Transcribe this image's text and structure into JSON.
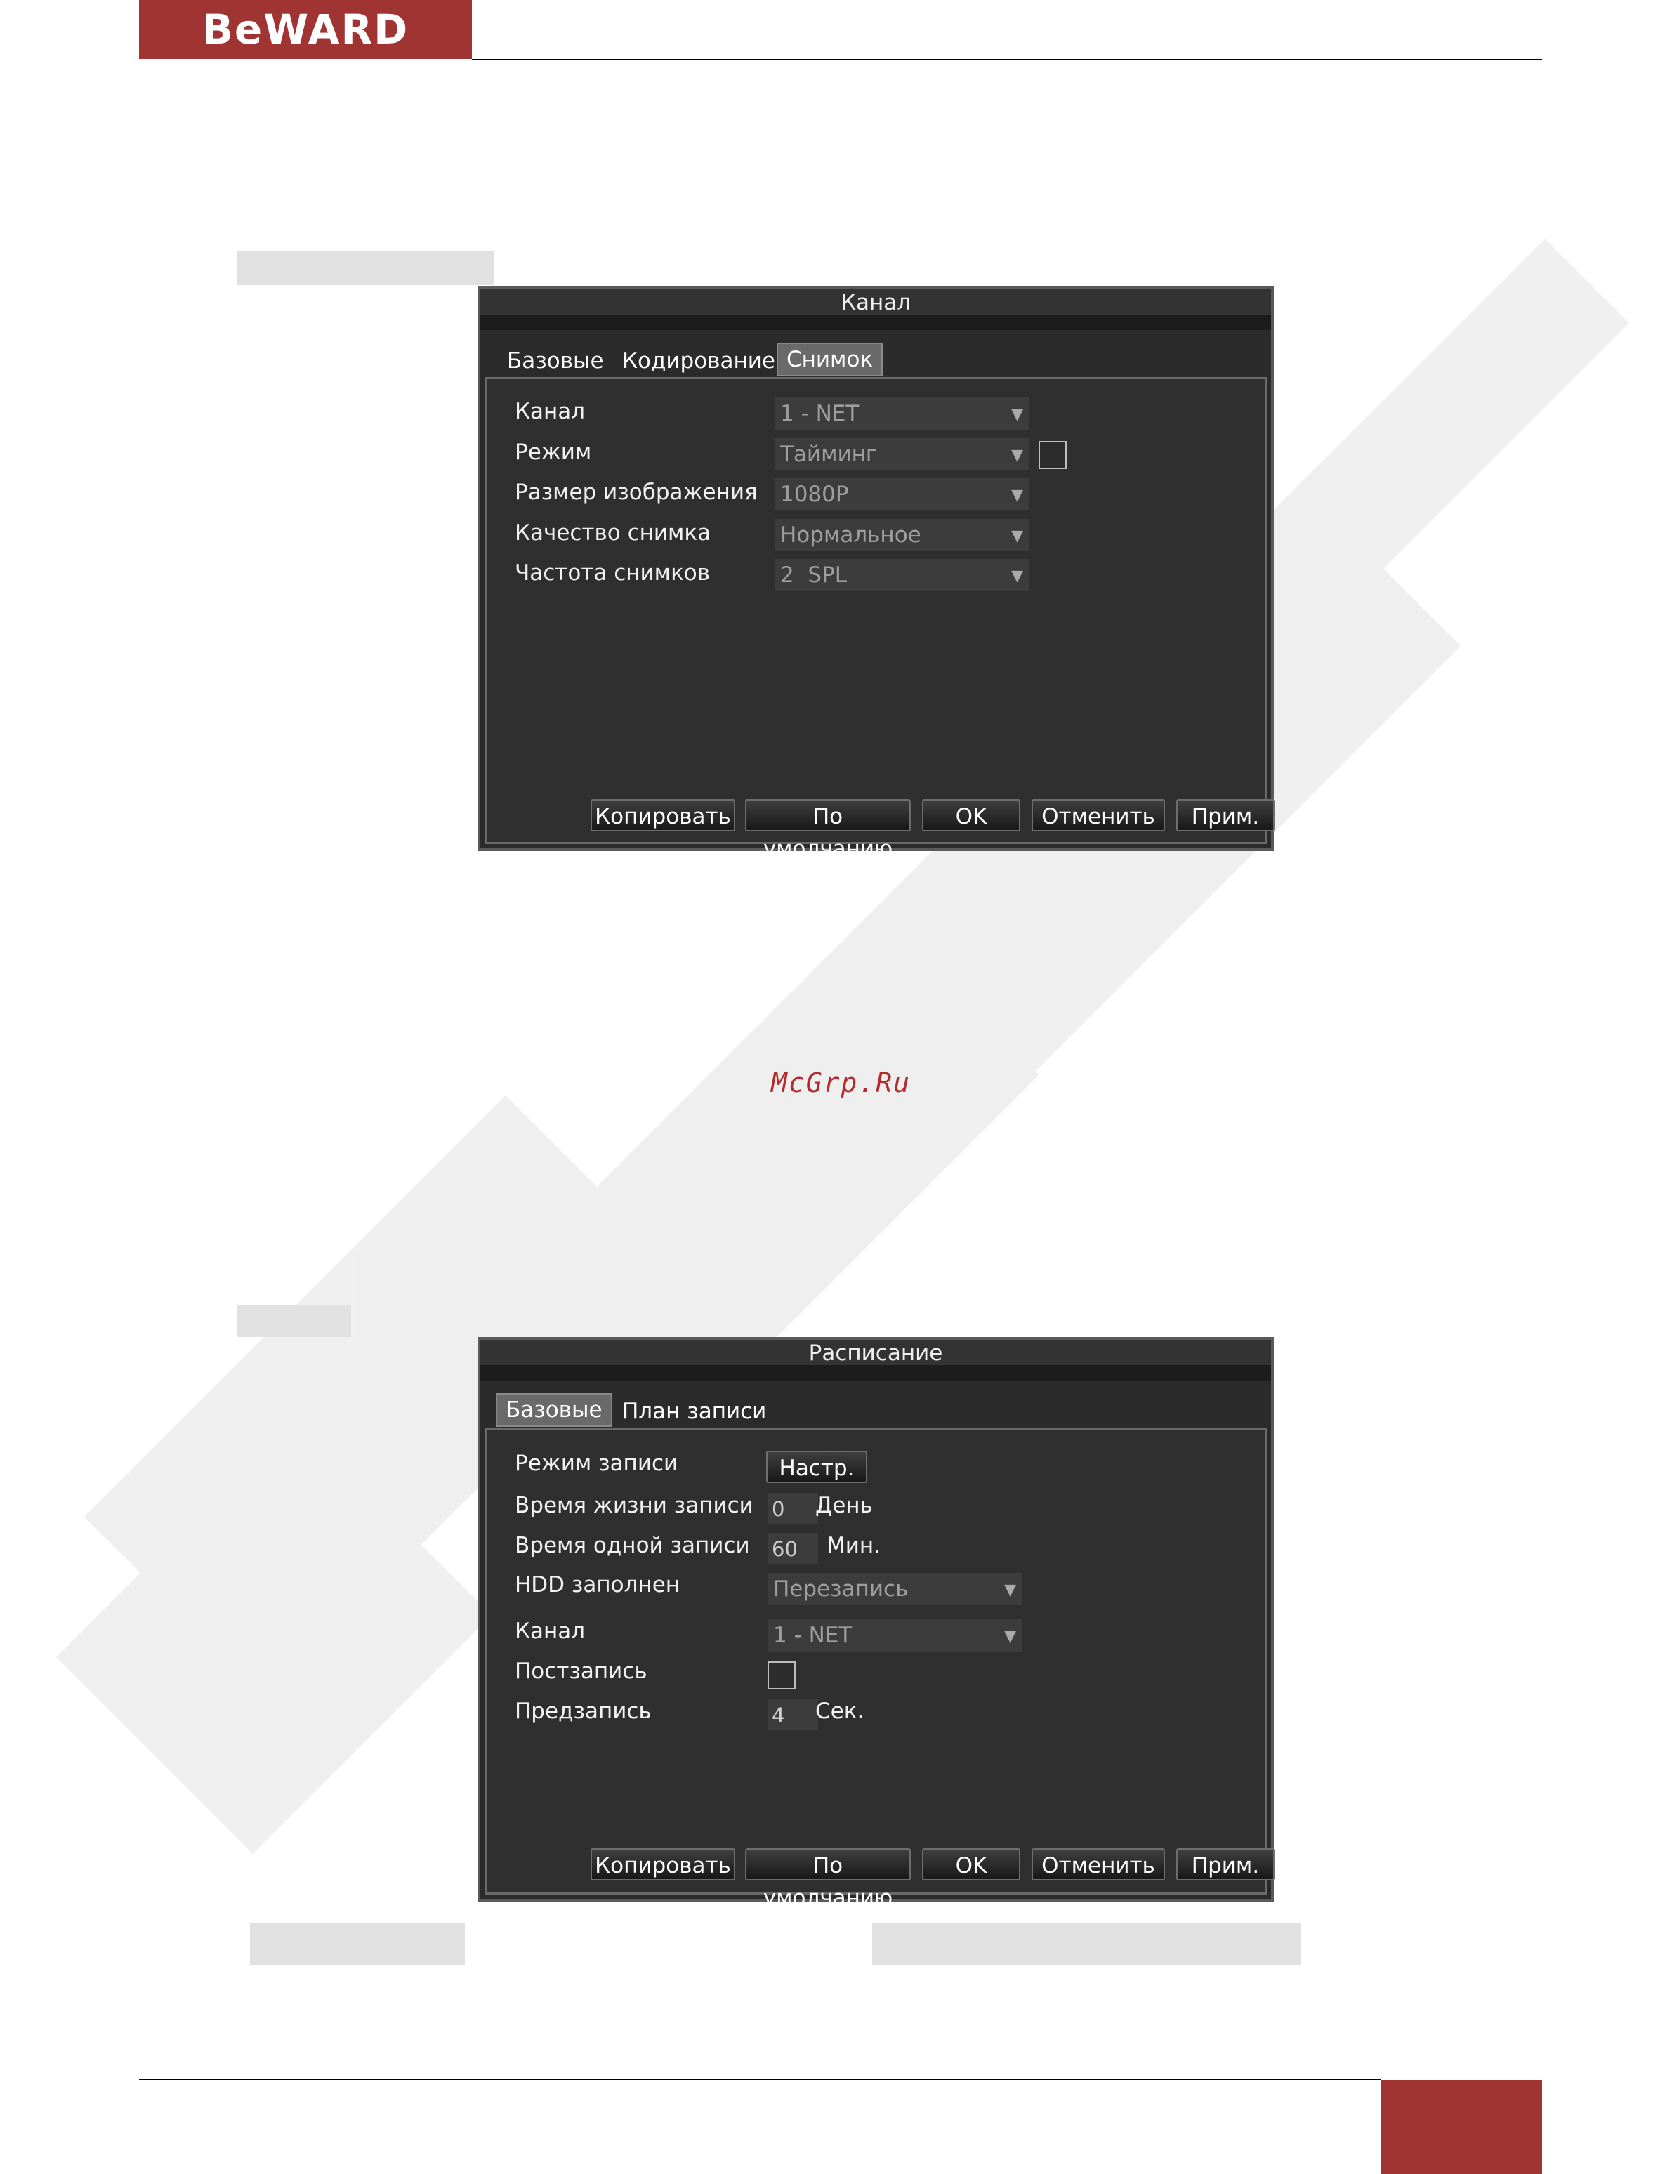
{
  "brand": {
    "logo": "BeWARD",
    "accent": "#a03433"
  },
  "watermark": {
    "site": "McGrp.Ru"
  },
  "dialog_channel": {
    "title": "Канал",
    "tabs": [
      "Базовые",
      "Кодирование",
      "Снимок"
    ],
    "active_tab": "Снимок",
    "fields": {
      "channel": {
        "label": "Канал",
        "value": "1 - NET"
      },
      "mode": {
        "label": "Режим",
        "value": "Тайминг"
      },
      "image_size": {
        "label": "Размер изображения",
        "value": "1080P"
      },
      "quality": {
        "label": "Качество снимка",
        "value": "Нормальное"
      },
      "frequency": {
        "label": "Частота снимков",
        "value": "2  SPL"
      }
    },
    "buttons": {
      "copy": "Копировать",
      "default": "По умолчанию",
      "ok": "OK",
      "cancel": "Отменить",
      "apply": "Прим."
    }
  },
  "dialog_schedule": {
    "title": "Расписание",
    "tabs": [
      "Базовые",
      "План записи"
    ],
    "active_tab": "Базовые",
    "fields": {
      "record_mode": {
        "label": "Режим записи",
        "button": "Настр."
      },
      "lifetime": {
        "label": "Время жизни записи",
        "value": "0",
        "unit": "День"
      },
      "single_record": {
        "label": "Время одной записи",
        "value": "60",
        "unit": "Мин."
      },
      "hdd_full": {
        "label": "HDD заполнен",
        "value": "Перезапись"
      },
      "channel": {
        "label": "Канал",
        "value": "1 - NET"
      },
      "post_record": {
        "label": "Постзапись"
      },
      "pre_record": {
        "label": "Предзапись",
        "value": "4",
        "unit": "Сек."
      }
    },
    "buttons": {
      "copy": "Копировать",
      "default": "По умолчанию",
      "ok": "OK",
      "cancel": "Отменить",
      "apply": "Прим."
    }
  }
}
